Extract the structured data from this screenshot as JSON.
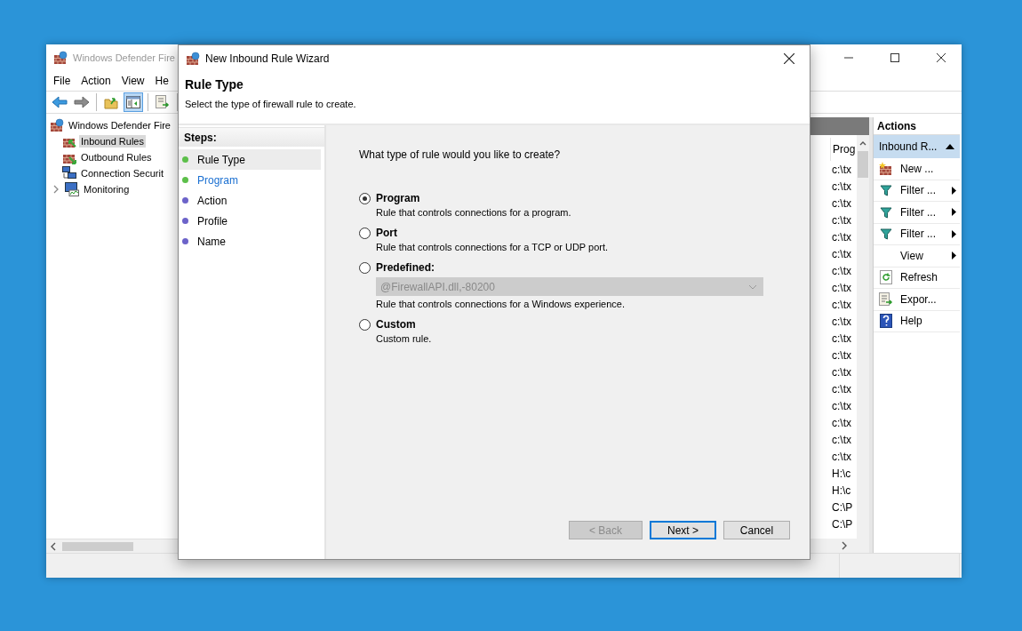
{
  "main_window": {
    "title": "Windows Defender Fire",
    "menu": [
      "File",
      "Action",
      "View",
      "He"
    ],
    "toolbar": [
      {
        "kind": "back",
        "selected": false
      },
      {
        "kind": "forward",
        "selected": false
      },
      {
        "kind": "separator"
      },
      {
        "kind": "up",
        "selected": false
      },
      {
        "kind": "pane",
        "selected": true
      },
      {
        "kind": "separator"
      },
      {
        "kind": "export",
        "selected": false
      },
      {
        "kind": "separator"
      }
    ],
    "tree": [
      {
        "label": "Windows Defender Fire",
        "kind": "firewall",
        "selected": false,
        "children": [
          {
            "label": "Inbound Rules",
            "kind": "inbound",
            "selected": true
          },
          {
            "label": "Outbound Rules",
            "kind": "outbound",
            "selected": false
          },
          {
            "label": "Connection Securit",
            "kind": "connection",
            "selected": false
          },
          {
            "label": "Monitoring",
            "kind": "monitoring",
            "selected": false,
            "expanded": false
          }
        ]
      }
    ],
    "rules_column": {
      "header": "Prog",
      "cells": [
        "c:\\tx",
        "c:\\tx",
        "c:\\tx",
        "c:\\tx",
        "c:\\tx",
        "c:\\tx",
        "c:\\tx",
        "c:\\tx",
        "c:\\tx",
        "c:\\tx",
        "c:\\tx",
        "c:\\tx",
        "c:\\tx",
        "c:\\tx",
        "c:\\tx",
        "c:\\tx",
        "c:\\tx",
        "c:\\tx",
        "H:\\c",
        "H:\\c",
        "C:\\P",
        "C:\\P"
      ]
    },
    "actions": {
      "title": "Actions",
      "section": {
        "label": "Inbound R...",
        "expanded": true
      },
      "items": [
        {
          "label": "New ...",
          "kind": "new",
          "submenu": false
        },
        {
          "label": "Filter ...",
          "kind": "filter",
          "submenu": true
        },
        {
          "label": "Filter ...",
          "kind": "filter",
          "submenu": true
        },
        {
          "label": "Filter ...",
          "kind": "filter",
          "submenu": true
        },
        {
          "label": "View",
          "kind": "none",
          "submenu": true
        },
        {
          "label": "Refresh",
          "kind": "refresh",
          "submenu": false
        },
        {
          "label": "Expor...",
          "kind": "export",
          "submenu": false
        },
        {
          "label": "Help",
          "kind": "help",
          "submenu": false
        }
      ]
    }
  },
  "wizard": {
    "title": "New Inbound Rule Wizard",
    "heading": "Rule Type",
    "subheading": "Select the type of firewall rule to create.",
    "steps_title": "Steps:",
    "steps": [
      {
        "label": "Rule Type",
        "selected": true,
        "link": false,
        "color": "#5cbf4a"
      },
      {
        "label": "Program",
        "selected": false,
        "link": true,
        "color": "#5cbf4a"
      },
      {
        "label": "Action",
        "selected": false,
        "link": false,
        "color": "#6c63c9"
      },
      {
        "label": "Profile",
        "selected": false,
        "link": false,
        "color": "#6c63c9"
      },
      {
        "label": "Name",
        "selected": false,
        "link": false,
        "color": "#6c63c9"
      }
    ],
    "question": "What type of rule would you like to create?",
    "options": [
      {
        "label": "Program",
        "description": "Rule that controls connections for a program.",
        "selected": true
      },
      {
        "label": "Port",
        "description": "Rule that controls connections for a TCP or UDP port.",
        "selected": false
      },
      {
        "label": "Predefined:",
        "description": "Rule that controls connections for a Windows experience.",
        "selected": false,
        "dropdown": {
          "value": "@FirewallAPI.dll,-80200",
          "disabled": true
        }
      },
      {
        "label": "Custom",
        "description": "Custom rule.",
        "selected": false
      }
    ],
    "buttons": [
      {
        "label": "< Back",
        "disabled": true,
        "default": false
      },
      {
        "label": "Next >",
        "disabled": false,
        "default": true
      },
      {
        "label": "Cancel",
        "disabled": false,
        "default": false
      }
    ]
  }
}
